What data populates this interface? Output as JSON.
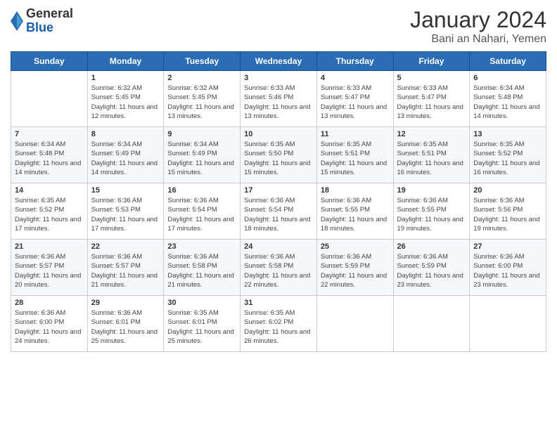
{
  "logo": {
    "general": "General",
    "blue": "Blue"
  },
  "header": {
    "title": "January 2024",
    "subtitle": "Bani an Nahari, Yemen"
  },
  "days": [
    "Sunday",
    "Monday",
    "Tuesday",
    "Wednesday",
    "Thursday",
    "Friday",
    "Saturday"
  ],
  "weeks": [
    [
      {
        "date": "",
        "sunrise": "",
        "sunset": "",
        "daylight": ""
      },
      {
        "date": "1",
        "sunrise": "Sunrise: 6:32 AM",
        "sunset": "Sunset: 5:45 PM",
        "daylight": "Daylight: 11 hours and 12 minutes."
      },
      {
        "date": "2",
        "sunrise": "Sunrise: 6:32 AM",
        "sunset": "Sunset: 5:45 PM",
        "daylight": "Daylight: 11 hours and 13 minutes."
      },
      {
        "date": "3",
        "sunrise": "Sunrise: 6:33 AM",
        "sunset": "Sunset: 5:46 PM",
        "daylight": "Daylight: 11 hours and 13 minutes."
      },
      {
        "date": "4",
        "sunrise": "Sunrise: 6:33 AM",
        "sunset": "Sunset: 5:47 PM",
        "daylight": "Daylight: 11 hours and 13 minutes."
      },
      {
        "date": "5",
        "sunrise": "Sunrise: 6:33 AM",
        "sunset": "Sunset: 5:47 PM",
        "daylight": "Daylight: 11 hours and 13 minutes."
      },
      {
        "date": "6",
        "sunrise": "Sunrise: 6:34 AM",
        "sunset": "Sunset: 5:48 PM",
        "daylight": "Daylight: 11 hours and 14 minutes."
      }
    ],
    [
      {
        "date": "7",
        "sunrise": "Sunrise: 6:34 AM",
        "sunset": "Sunset: 5:48 PM",
        "daylight": "Daylight: 11 hours and 14 minutes."
      },
      {
        "date": "8",
        "sunrise": "Sunrise: 6:34 AM",
        "sunset": "Sunset: 5:49 PM",
        "daylight": "Daylight: 11 hours and 14 minutes."
      },
      {
        "date": "9",
        "sunrise": "Sunrise: 6:34 AM",
        "sunset": "Sunset: 5:49 PM",
        "daylight": "Daylight: 11 hours and 15 minutes."
      },
      {
        "date": "10",
        "sunrise": "Sunrise: 6:35 AM",
        "sunset": "Sunset: 5:50 PM",
        "daylight": "Daylight: 11 hours and 15 minutes."
      },
      {
        "date": "11",
        "sunrise": "Sunrise: 6:35 AM",
        "sunset": "Sunset: 5:51 PM",
        "daylight": "Daylight: 11 hours and 15 minutes."
      },
      {
        "date": "12",
        "sunrise": "Sunrise: 6:35 AM",
        "sunset": "Sunset: 5:51 PM",
        "daylight": "Daylight: 11 hours and 16 minutes."
      },
      {
        "date": "13",
        "sunrise": "Sunrise: 6:35 AM",
        "sunset": "Sunset: 5:52 PM",
        "daylight": "Daylight: 11 hours and 16 minutes."
      }
    ],
    [
      {
        "date": "14",
        "sunrise": "Sunrise: 6:35 AM",
        "sunset": "Sunset: 5:52 PM",
        "daylight": "Daylight: 11 hours and 17 minutes."
      },
      {
        "date": "15",
        "sunrise": "Sunrise: 6:36 AM",
        "sunset": "Sunset: 5:53 PM",
        "daylight": "Daylight: 11 hours and 17 minutes."
      },
      {
        "date": "16",
        "sunrise": "Sunrise: 6:36 AM",
        "sunset": "Sunset: 5:54 PM",
        "daylight": "Daylight: 11 hours and 17 minutes."
      },
      {
        "date": "17",
        "sunrise": "Sunrise: 6:36 AM",
        "sunset": "Sunset: 5:54 PM",
        "daylight": "Daylight: 11 hours and 18 minutes."
      },
      {
        "date": "18",
        "sunrise": "Sunrise: 6:36 AM",
        "sunset": "Sunset: 5:55 PM",
        "daylight": "Daylight: 11 hours and 18 minutes."
      },
      {
        "date": "19",
        "sunrise": "Sunrise: 6:36 AM",
        "sunset": "Sunset: 5:55 PM",
        "daylight": "Daylight: 11 hours and 19 minutes."
      },
      {
        "date": "20",
        "sunrise": "Sunrise: 6:36 AM",
        "sunset": "Sunset: 5:56 PM",
        "daylight": "Daylight: 11 hours and 19 minutes."
      }
    ],
    [
      {
        "date": "21",
        "sunrise": "Sunrise: 6:36 AM",
        "sunset": "Sunset: 5:57 PM",
        "daylight": "Daylight: 11 hours and 20 minutes."
      },
      {
        "date": "22",
        "sunrise": "Sunrise: 6:36 AM",
        "sunset": "Sunset: 5:57 PM",
        "daylight": "Daylight: 11 hours and 21 minutes."
      },
      {
        "date": "23",
        "sunrise": "Sunrise: 6:36 AM",
        "sunset": "Sunset: 5:58 PM",
        "daylight": "Daylight: 11 hours and 21 minutes."
      },
      {
        "date": "24",
        "sunrise": "Sunrise: 6:36 AM",
        "sunset": "Sunset: 5:58 PM",
        "daylight": "Daylight: 11 hours and 22 minutes."
      },
      {
        "date": "25",
        "sunrise": "Sunrise: 6:36 AM",
        "sunset": "Sunset: 5:59 PM",
        "daylight": "Daylight: 11 hours and 22 minutes."
      },
      {
        "date": "26",
        "sunrise": "Sunrise: 6:36 AM",
        "sunset": "Sunset: 5:59 PM",
        "daylight": "Daylight: 11 hours and 23 minutes."
      },
      {
        "date": "27",
        "sunrise": "Sunrise: 6:36 AM",
        "sunset": "Sunset: 6:00 PM",
        "daylight": "Daylight: 11 hours and 23 minutes."
      }
    ],
    [
      {
        "date": "28",
        "sunrise": "Sunrise: 6:36 AM",
        "sunset": "Sunset: 6:00 PM",
        "daylight": "Daylight: 11 hours and 24 minutes."
      },
      {
        "date": "29",
        "sunrise": "Sunrise: 6:36 AM",
        "sunset": "Sunset: 6:01 PM",
        "daylight": "Daylight: 11 hours and 25 minutes."
      },
      {
        "date": "30",
        "sunrise": "Sunrise: 6:35 AM",
        "sunset": "Sunset: 6:01 PM",
        "daylight": "Daylight: 11 hours and 25 minutes."
      },
      {
        "date": "31",
        "sunrise": "Sunrise: 6:35 AM",
        "sunset": "Sunset: 6:02 PM",
        "daylight": "Daylight: 11 hours and 26 minutes."
      },
      {
        "date": "",
        "sunrise": "",
        "sunset": "",
        "daylight": ""
      },
      {
        "date": "",
        "sunrise": "",
        "sunset": "",
        "daylight": ""
      },
      {
        "date": "",
        "sunrise": "",
        "sunset": "",
        "daylight": ""
      }
    ]
  ]
}
